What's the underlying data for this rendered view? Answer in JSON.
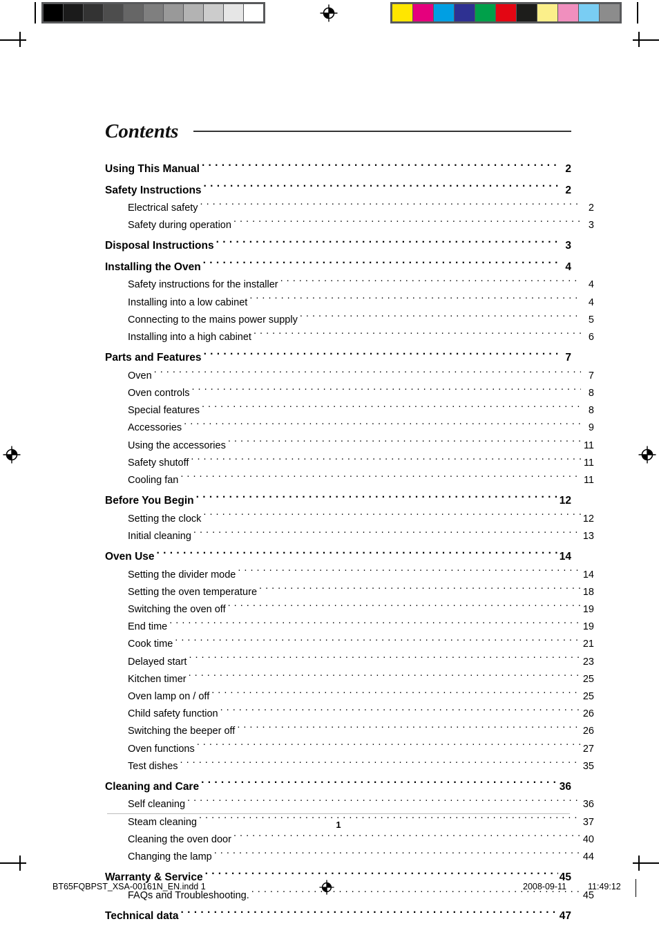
{
  "document": {
    "title": "Contents",
    "page_number": "1"
  },
  "prepress": {
    "grayscale_label": "grayscale-calibration-strip",
    "grayscale_swatches": [
      "#000000",
      "#1b1b1b",
      "#333333",
      "#4d4d4d",
      "#666666",
      "#7f7f7f",
      "#999999",
      "#b3b3b3",
      "#cccccc",
      "#e6e6e6",
      "#ffffff"
    ],
    "color_label": "color-calibration-strip",
    "color_swatches": [
      "#ffe600",
      "#e5007d",
      "#009fe3",
      "#2e3192",
      "#00a04a",
      "#e30613",
      "#1d1d1b",
      "#fbef8a",
      "#f08fbe",
      "#79cdf3",
      "#8c8c8c"
    ],
    "registration_icon": "registration-target-icon"
  },
  "toc": {
    "entries": [
      {
        "level": 1,
        "label": "Using This Manual",
        "page": "2"
      },
      {
        "level": 1,
        "label": "Safety Instructions",
        "page": "2"
      },
      {
        "level": 2,
        "label": "Electrical safety",
        "page": "2"
      },
      {
        "level": 2,
        "label": "Safety during operation",
        "page": "3"
      },
      {
        "level": 1,
        "label": "Disposal Instructions",
        "page": "3"
      },
      {
        "level": 1,
        "label": "Installing the Oven",
        "page": "4"
      },
      {
        "level": 2,
        "label": "Safety instructions for the installer",
        "page": "4"
      },
      {
        "level": 2,
        "label": "Installing into a low cabinet",
        "page": "4"
      },
      {
        "level": 2,
        "label": "Connecting to the mains power supply",
        "page": "5"
      },
      {
        "level": 2,
        "label": "Installing into a high cabinet",
        "page": "6"
      },
      {
        "level": 1,
        "label": "Parts and Features",
        "page": "7"
      },
      {
        "level": 2,
        "label": "Oven",
        "page": "7"
      },
      {
        "level": 2,
        "label": "Oven controls",
        "page": "8"
      },
      {
        "level": 2,
        "label": "Special features",
        "page": "8"
      },
      {
        "level": 2,
        "label": "Accessories",
        "page": "9"
      },
      {
        "level": 2,
        "label": "Using the accessories",
        "page": "11"
      },
      {
        "level": 2,
        "label": "Safety shutoff",
        "page": "11"
      },
      {
        "level": 2,
        "label": "Cooling fan",
        "page": "11"
      },
      {
        "level": 1,
        "label": "Before You Begin",
        "page": "12"
      },
      {
        "level": 2,
        "label": "Setting the clock",
        "page": "12"
      },
      {
        "level": 2,
        "label": "Initial cleaning",
        "page": "13"
      },
      {
        "level": 1,
        "label": "Oven Use",
        "page": "14"
      },
      {
        "level": 2,
        "label": "Setting the divider mode",
        "page": "14"
      },
      {
        "level": 2,
        "label": "Setting the oven temperature",
        "page": "18"
      },
      {
        "level": 2,
        "label": "Switching the oven off",
        "page": "19"
      },
      {
        "level": 2,
        "label": "End time",
        "page": "19"
      },
      {
        "level": 2,
        "label": "Cook time",
        "page": "21"
      },
      {
        "level": 2,
        "label": "Delayed start",
        "page": "23"
      },
      {
        "level": 2,
        "label": "Kitchen timer",
        "page": "25"
      },
      {
        "level": 2,
        "label": "Oven lamp on / off",
        "page": "25"
      },
      {
        "level": 2,
        "label": "Child safety function",
        "page": "26"
      },
      {
        "level": 2,
        "label": "Switching the beeper off",
        "page": "26"
      },
      {
        "level": 2,
        "label": "Oven functions",
        "page": "27"
      },
      {
        "level": 2,
        "label": "Test dishes",
        "page": "35"
      },
      {
        "level": 1,
        "label": "Cleaning and Care",
        "page": "36"
      },
      {
        "level": 2,
        "label": "Self cleaning",
        "page": "36"
      },
      {
        "level": 2,
        "label": "Steam cleaning",
        "page": "37"
      },
      {
        "level": 2,
        "label": "Cleaning the oven door",
        "page": "40"
      },
      {
        "level": 2,
        "label": "Changing the lamp",
        "page": "44"
      },
      {
        "level": 1,
        "label": "Warranty & Service",
        "page": "45"
      },
      {
        "level": 2,
        "label": "FAQs and Troubleshooting.",
        "page": "45"
      },
      {
        "level": 1,
        "label": "Technical data",
        "page": "47"
      }
    ]
  },
  "imprint": {
    "filename": "BT65FQBPST_XSA-00161N_EN.indd   1",
    "date": "2008-09-11",
    "time": "11:49:12"
  }
}
